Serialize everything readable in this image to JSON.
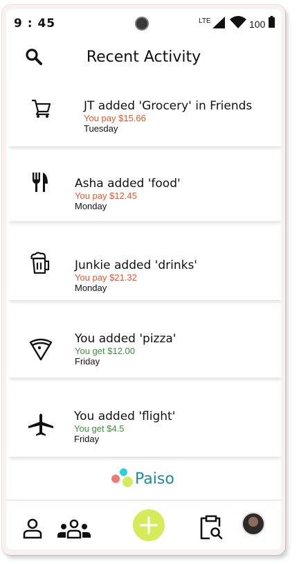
{
  "status_bar": {
    "time": "9 : 45",
    "network": "LTE",
    "battery": "100"
  },
  "header": {
    "title": "Recent Activity"
  },
  "activities": [
    {
      "icon": "cart-icon",
      "title": "JT added 'Grocery' in Friends",
      "amount": "You pay $15.66",
      "direction": "pay",
      "day": "Tuesday"
    },
    {
      "icon": "fork-knife-icon",
      "title": "Asha added 'food'",
      "amount": "You pay $12.45",
      "direction": "pay",
      "day": "Monday"
    },
    {
      "icon": "beer-mug-icon",
      "title": "Junkie added 'drinks'",
      "amount": "You pay $21.32",
      "direction": "pay",
      "day": "Monday"
    },
    {
      "icon": "pizza-icon",
      "title": "You added 'pizza'",
      "amount": "You get $12.00",
      "direction": "get",
      "day": "Friday"
    },
    {
      "icon": "airplane-icon",
      "title": "You added 'flight'",
      "amount": "You get $4.5",
      "direction": "get",
      "day": "Friday"
    }
  ],
  "brand": {
    "name": "Paiso"
  },
  "colors": {
    "pay": "#e8562a",
    "get": "#3d8f3d",
    "brand": "#1c8a92",
    "fab": "#d7eb5a"
  },
  "bottom_nav": [
    "person-icon",
    "group-icon",
    "add-icon",
    "clipboard-search-icon",
    "avatar"
  ]
}
